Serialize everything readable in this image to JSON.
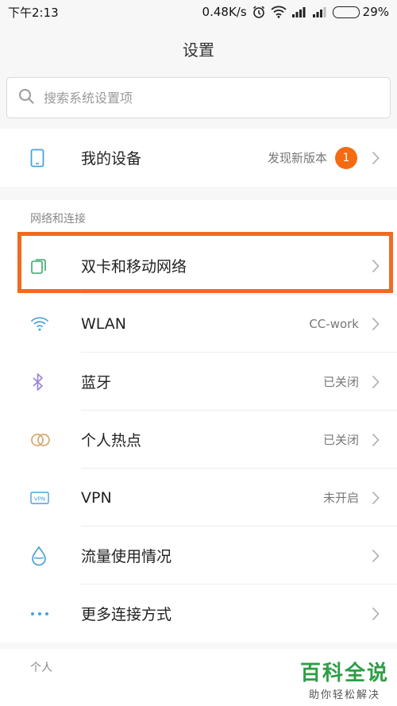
{
  "status": {
    "time": "下午2:13",
    "speed": "0.48K/s",
    "battery": "29%",
    "battery_level": 0.29
  },
  "header": {
    "title": "设置"
  },
  "search": {
    "placeholder": "搜索系统设置项"
  },
  "device": {
    "label": "我的设备",
    "value": "发现新版本",
    "badge": "1"
  },
  "network": {
    "section_title": "网络和连接",
    "items": [
      {
        "label": "双卡和移动网络",
        "value": ""
      },
      {
        "label": "WLAN",
        "value": "CC-work"
      },
      {
        "label": "蓝牙",
        "value": "已关闭"
      },
      {
        "label": "个人热点",
        "value": "已关闭"
      },
      {
        "label": "VPN",
        "value": "未开启"
      },
      {
        "label": "流量使用情况",
        "value": ""
      },
      {
        "label": "更多连接方式",
        "value": ""
      }
    ]
  },
  "personal": {
    "section_title": "个人"
  },
  "watermark": {
    "title": "百科全说",
    "subtitle": "助你轻松解决"
  },
  "colors": {
    "accent": "#f26a21",
    "badge": "#f56a12",
    "wlan_icon": "#4aa3d6",
    "bluetooth_icon": "#9b86d6"
  }
}
